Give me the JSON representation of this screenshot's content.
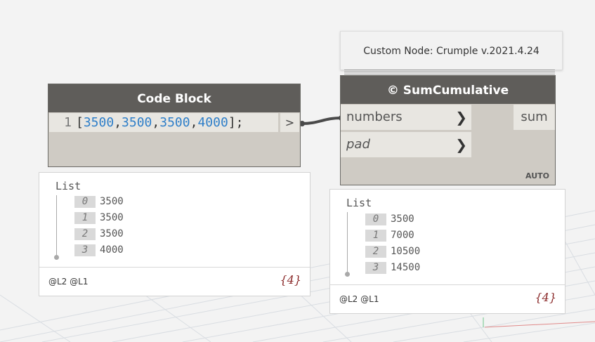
{
  "tooltip": {
    "text": "Custom Node: Crumple v.2021.4.24"
  },
  "code_block": {
    "title": "Code Block",
    "line_number": "1",
    "code_open": "[",
    "values": [
      "3500",
      "3500",
      "3500",
      "4000"
    ],
    "code_close": "];",
    "output_port": ">"
  },
  "sum_node": {
    "title": "© SumCumulative",
    "inputs": [
      {
        "label": "numbers",
        "chevron": "❯"
      },
      {
        "label": "pad",
        "chevron": "❯"
      }
    ],
    "output": "sum",
    "lacing": "AUTO"
  },
  "preview_left": {
    "title": "List",
    "items": [
      {
        "index": "0",
        "value": "3500"
      },
      {
        "index": "1",
        "value": "3500"
      },
      {
        "index": "2",
        "value": "3500"
      },
      {
        "index": "3",
        "value": "4000"
      }
    ],
    "levels": "@L2 @L1",
    "count": "{4}"
  },
  "preview_right": {
    "title": "List",
    "items": [
      {
        "index": "0",
        "value": "3500"
      },
      {
        "index": "1",
        "value": "7000"
      },
      {
        "index": "2",
        "value": "10500"
      },
      {
        "index": "3",
        "value": "14500"
      }
    ],
    "levels": "@L2 @L1",
    "count": "{4}"
  },
  "colors": {
    "header": "#5f5d5a",
    "body": "#cfcbc4",
    "number_literal": "#2f7fc9",
    "count": "#8b2a2a"
  }
}
